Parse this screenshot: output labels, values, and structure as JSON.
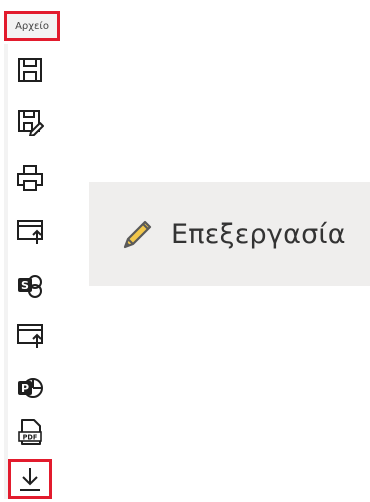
{
  "menu": {
    "tab_label": "Αρχείο",
    "items": [
      {
        "icon": "save-icon"
      },
      {
        "icon": "save-as-icon"
      },
      {
        "icon": "print-icon"
      },
      {
        "icon": "export-icon"
      },
      {
        "icon": "sharepoint-icon"
      },
      {
        "icon": "publish-icon"
      },
      {
        "icon": "powerpoint-icon"
      },
      {
        "icon": "pdf-icon"
      },
      {
        "icon": "download-icon"
      }
    ]
  },
  "edit": {
    "icon": "pencil-icon",
    "label": "Επεξεργασία"
  },
  "colors": {
    "highlight_border": "#e21b2d",
    "banner_background": "#efeeed",
    "icon_stroke": "#1f1f1f",
    "pencil_fill": "#f2c74b"
  }
}
